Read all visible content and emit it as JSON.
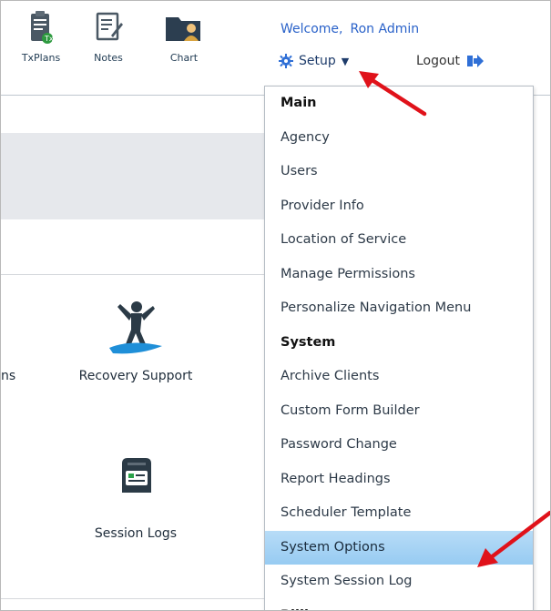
{
  "toolbar": {
    "txplans_label": "TxPlans",
    "notes_label": "Notes",
    "chart_label": "Chart"
  },
  "user": {
    "welcome_label": "Welcome,",
    "name": "Ron Admin"
  },
  "setup": {
    "label": "Setup"
  },
  "logout": {
    "label": "Logout"
  },
  "tiles": {
    "partial_label": "ns",
    "recovery_support": "Recovery Support",
    "session_logs": "Session Logs"
  },
  "menu": {
    "items": [
      {
        "label": "Main",
        "type": "header"
      },
      {
        "label": "Agency"
      },
      {
        "label": "Users"
      },
      {
        "label": "Provider Info"
      },
      {
        "label": "Location of Service"
      },
      {
        "label": "Manage Permissions"
      },
      {
        "label": "Personalize Navigation Menu"
      },
      {
        "label": "System",
        "type": "header"
      },
      {
        "label": "Archive Clients"
      },
      {
        "label": "Custom Form Builder"
      },
      {
        "label": "Password Change"
      },
      {
        "label": "Report Headings"
      },
      {
        "label": "Scheduler Template"
      },
      {
        "label": "System Options",
        "state": "highlighted"
      },
      {
        "label": "System Session Log"
      },
      {
        "label": "Billi",
        "type": "header"
      }
    ]
  },
  "colors": {
    "link_blue": "#2a62c9",
    "highlight": "#a8d4f5",
    "annotation_arrow": "#e0121a"
  }
}
